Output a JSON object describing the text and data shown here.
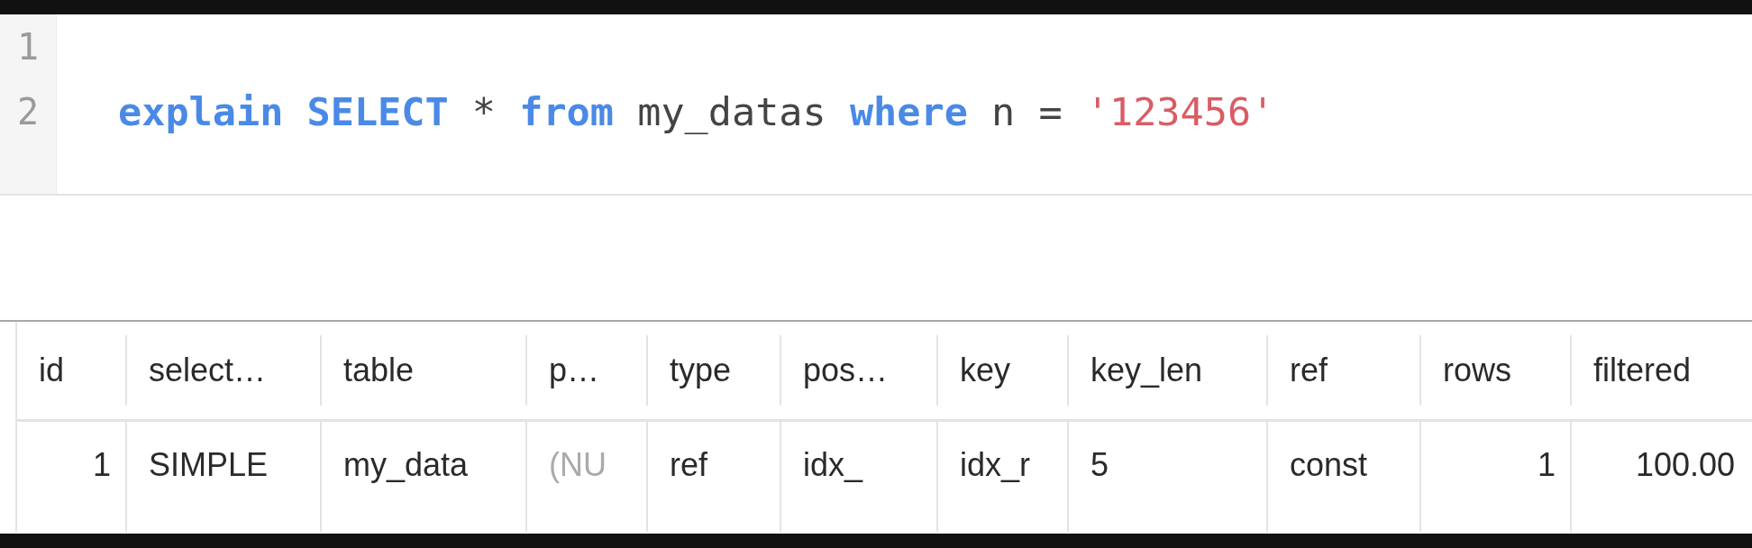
{
  "editor": {
    "lines": [
      {
        "number": "1"
      },
      {
        "number": "2",
        "tokens": [
          {
            "kind": "keyword",
            "text": "explain "
          },
          {
            "kind": "keyword",
            "text": "SELECT "
          },
          {
            "kind": "plain",
            "text": "* "
          },
          {
            "kind": "keyword",
            "text": "from "
          },
          {
            "kind": "plain",
            "text": "my_datas "
          },
          {
            "kind": "keyword",
            "text": "where "
          },
          {
            "kind": "plain",
            "text": "n = "
          },
          {
            "kind": "string",
            "text": "'123456'"
          }
        ]
      }
    ]
  },
  "results": {
    "columns": [
      "id",
      "select…",
      "table",
      "p…",
      "type",
      "pos…",
      "key",
      "key_len",
      "ref",
      "rows",
      "filtered"
    ],
    "rows": [
      [
        {
          "kind": "number",
          "text": "1"
        },
        {
          "kind": "text",
          "text": "SIMPLE"
        },
        {
          "kind": "text",
          "text": "my_data"
        },
        {
          "kind": "null",
          "text": "(NU"
        },
        {
          "kind": "text",
          "text": "ref"
        },
        {
          "kind": "text",
          "text": "idx_"
        },
        {
          "kind": "text",
          "text": "idx_r"
        },
        {
          "kind": "text",
          "text": "5"
        },
        {
          "kind": "text",
          "text": "const"
        },
        {
          "kind": "number",
          "text": "1"
        },
        {
          "kind": "number",
          "text": "100.00"
        }
      ]
    ]
  }
}
